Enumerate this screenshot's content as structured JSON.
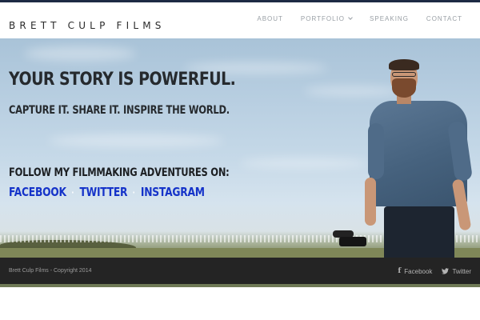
{
  "site": {
    "logo": "BRETT CULP FILMS"
  },
  "nav": {
    "items": [
      {
        "label": "ABOUT"
      },
      {
        "label": "PORTFOLIO"
      },
      {
        "label": "SPEAKING"
      },
      {
        "label": "CONTACT"
      }
    ]
  },
  "hero": {
    "headline": "YOUR STORY IS POWERFUL.",
    "subline": "CAPTURE IT.  SHARE IT.  INSPIRE THE WORLD.",
    "follow_text": "FOLLOW MY FILMMAKING ADVENTURES ON:",
    "social_links": [
      {
        "label": "FACEBOOK"
      },
      {
        "label": "TWITTER"
      },
      {
        "label": "INSTAGRAM"
      }
    ],
    "separator": "·"
  },
  "footer": {
    "copyright": "Brett Culp Films - Copyright 2014",
    "links": [
      {
        "label": "Facebook",
        "icon": "facebook-icon"
      },
      {
        "label": "Twitter",
        "icon": "twitter-icon"
      }
    ]
  },
  "colors": {
    "top_bar": "#1d2a44",
    "link_blue": "#1533c9",
    "footer_bg": "#242424"
  }
}
